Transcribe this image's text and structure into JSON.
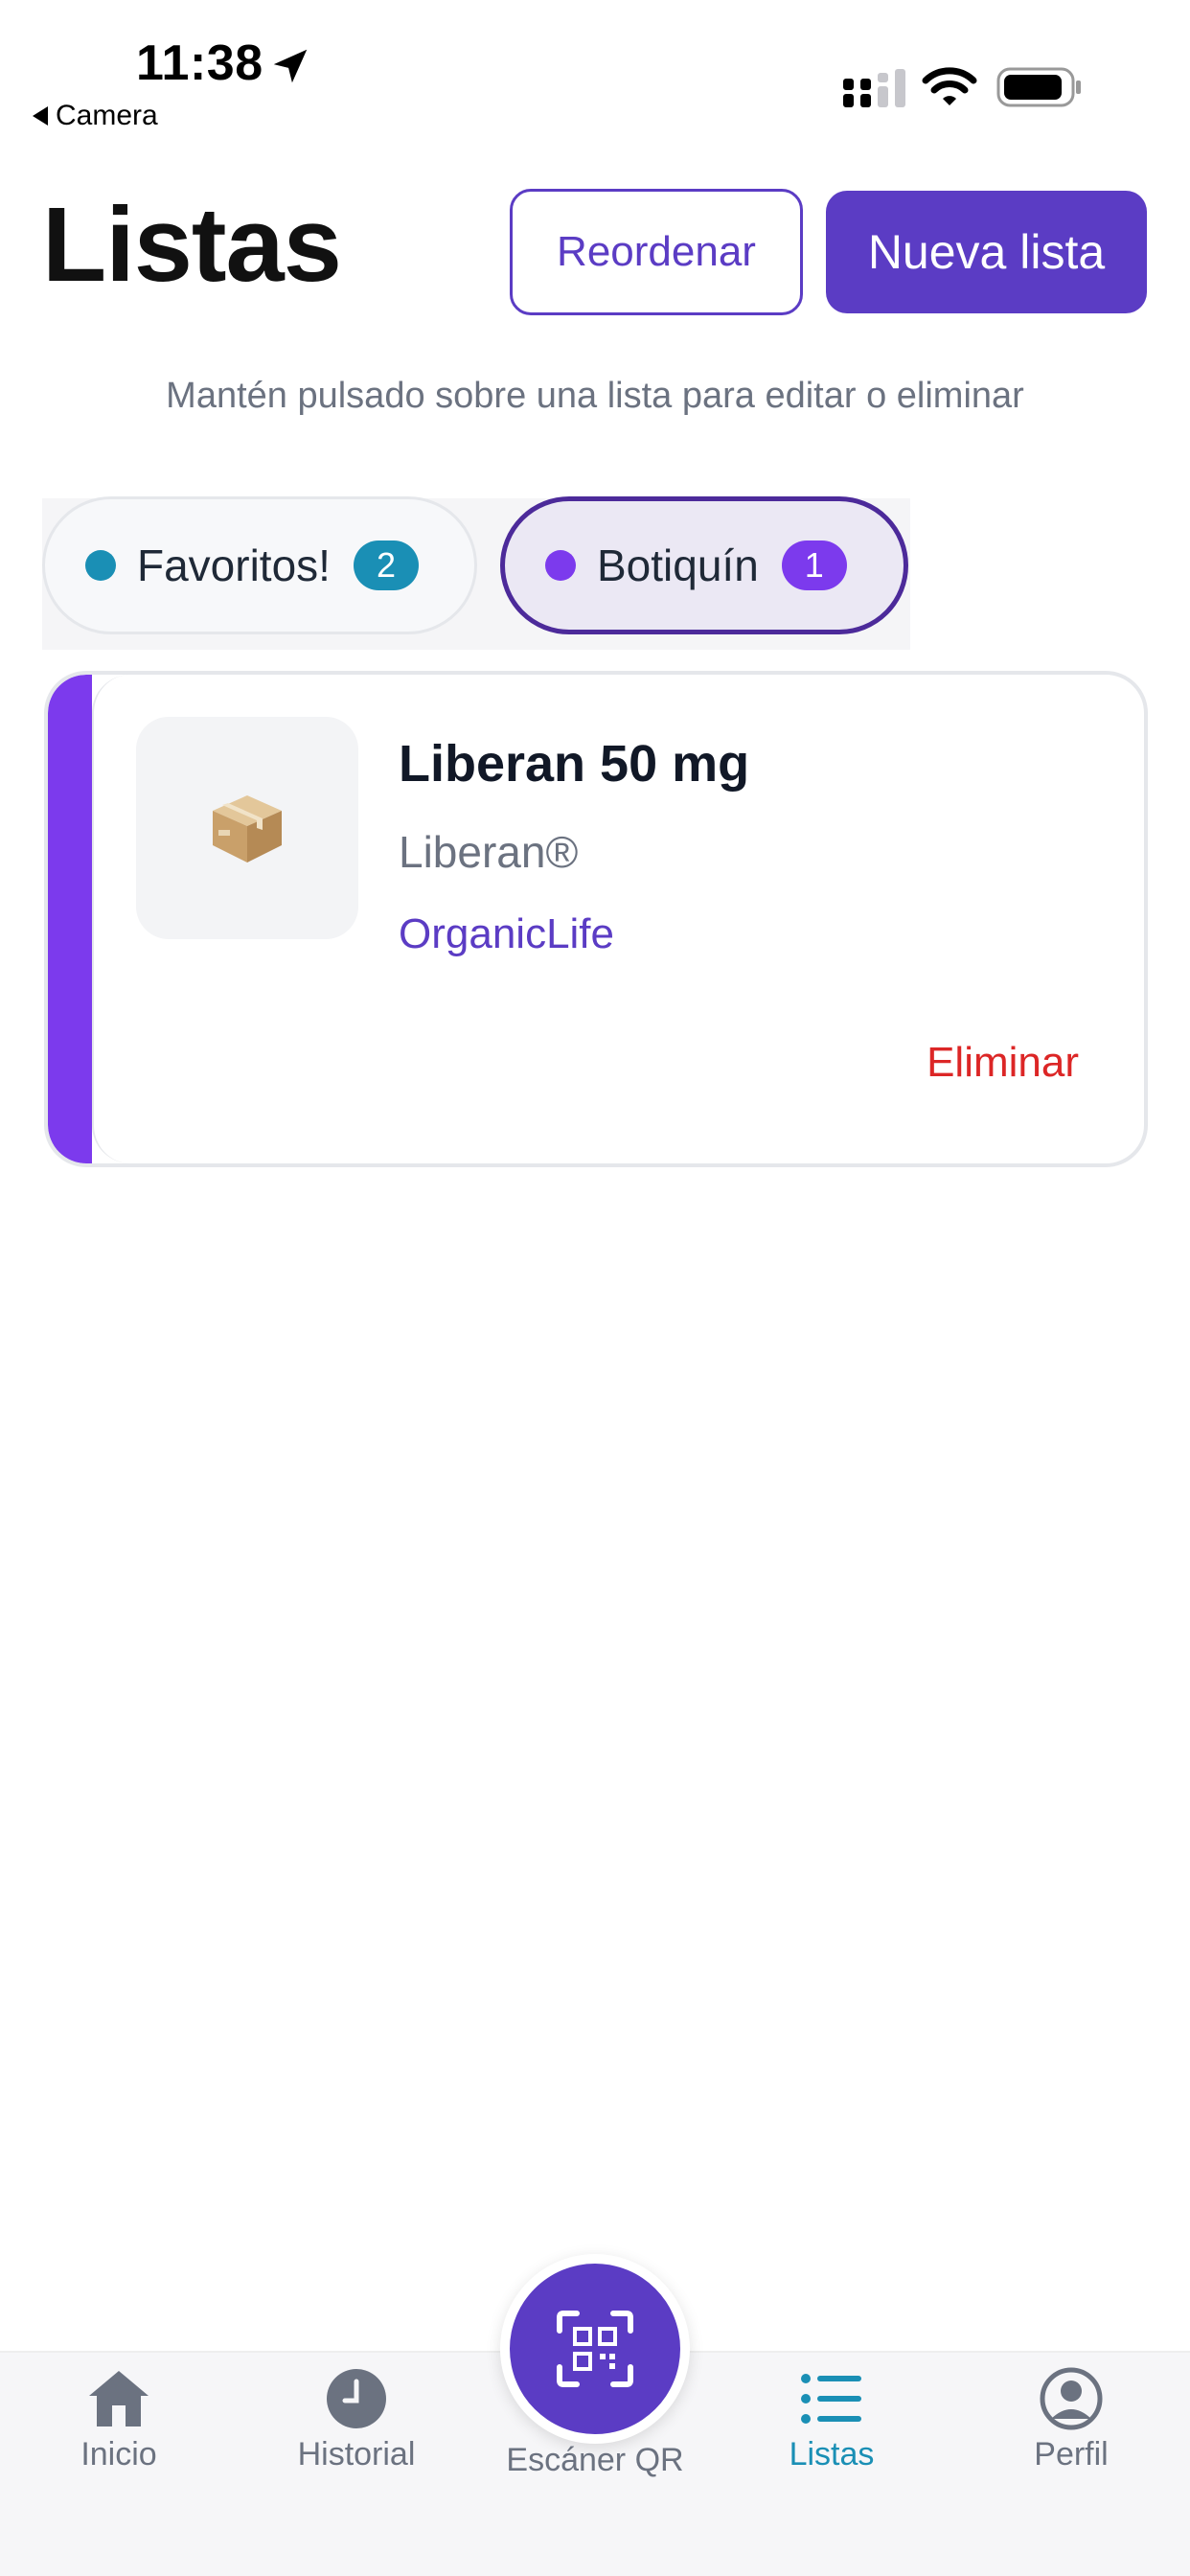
{
  "status_bar": {
    "time": "11:38",
    "back_label": "Camera"
  },
  "header": {
    "title": "Listas",
    "reorder_label": "Reordenar",
    "new_list_label": "Nueva lista",
    "hint": "Mantén pulsado sobre una lista para editar o eliminar"
  },
  "chips": [
    {
      "label": "Favoritos!",
      "count": "2",
      "color": "#1a8fb5",
      "selected": false
    },
    {
      "label": "Botiquín",
      "count": "1",
      "color": "#7c3aed",
      "selected": true
    }
  ],
  "items": [
    {
      "name": "Liberan 50 mg",
      "brand": "Liberan®",
      "lab": "OrganicLife",
      "delete_label": "Eliminar",
      "icon": "package-box-icon"
    }
  ],
  "nav": {
    "home": "Inicio",
    "history": "Historial",
    "scanner": "Escáner QR",
    "lists": "Listas",
    "profile": "Perfil",
    "active": "lists"
  },
  "colors": {
    "primary": "#5b3cc4",
    "accent_purple": "#7c3aed",
    "accent_teal": "#1a8fb5",
    "danger": "#dc2626"
  }
}
